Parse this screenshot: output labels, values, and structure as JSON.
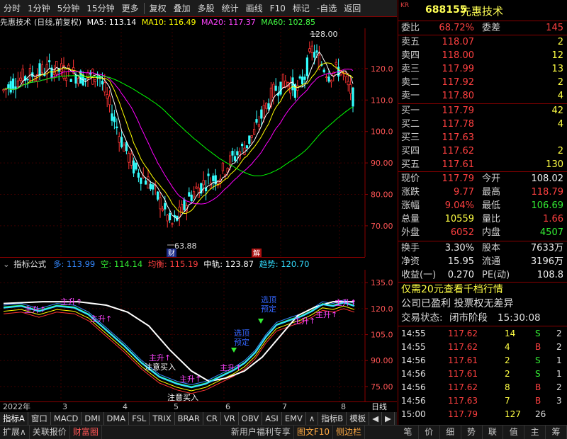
{
  "toolbar": {
    "items": [
      "分时",
      "1分钟",
      "5分钟",
      "15分钟",
      "更多",
      "复权",
      "叠加",
      "多股",
      "统计",
      "画线",
      "F10",
      "标记",
      "-自选",
      "返回"
    ]
  },
  "title_line": {
    "stock": "先惠技术",
    "period": "(日线,前复权)",
    "ma5": "MA5: 113.14",
    "ma10": "MA10: 116.49",
    "ma20": "MA20: 117.37",
    "ma60": "MA60: 102.85"
  },
  "price_chart": {
    "high_label": "128.00",
    "low_label": "63.88",
    "axis_ticks": [
      "120.0",
      "110.0",
      "100.0",
      "90.00",
      "80.00",
      "70.00"
    ],
    "tag_cai": "财",
    "tag_jie": "解",
    "colors": {
      "ma5": "#ffffff",
      "ma10": "#ffff00",
      "ma20": "#ff00ff",
      "ma60": "#00ff00",
      "up": "#ff3333",
      "down": "#33ffff"
    }
  },
  "indicator": {
    "label": "指标公式",
    "duo": "多: 113.99",
    "kong": "空: 114.14",
    "junheng": "均衡: 115.19",
    "zhonggui": "中轨: 123.87",
    "qushi": "趋势: 120.70",
    "axis_ticks": [
      "135.0",
      "120.0",
      "105.0",
      "90.00",
      "75.00"
    ],
    "annotations": {
      "rise": "主升↑",
      "note_buy": "注意买入",
      "select_a": "选顶",
      "select_b": "预定",
      "select_c": "选顶",
      "select_d": "预定"
    }
  },
  "date_axis": {
    "labels": [
      "2022年",
      "3",
      "4",
      "5",
      "6",
      "7",
      "8"
    ],
    "period_button": "日线"
  },
  "bottom_tabs": [
    "指标A",
    "窗口",
    "MACD",
    "DMI",
    "DMA",
    "FSL",
    "TRIX",
    "BRAR",
    "CR",
    "VR",
    "OBV",
    "ASI",
    "EMV",
    "∧",
    "指标B",
    "模板",
    "◀",
    "▶"
  ],
  "status_bar": [
    "扩展∧",
    "关联报价",
    "财富圈",
    "新用户福利专享",
    "图文F10",
    "侧边栏"
  ],
  "quote": {
    "kr": "KR",
    "code": "688155",
    "name": "先惠技术",
    "webi_label": "委比",
    "webi": "68.72%",
    "wecha_label": "委差",
    "wecha": "145",
    "sell": [
      {
        "label": "卖五",
        "price": "118.07",
        "vol": "2"
      },
      {
        "label": "卖四",
        "price": "118.00",
        "vol": "12"
      },
      {
        "label": "卖三",
        "price": "117.99",
        "vol": "13"
      },
      {
        "label": "卖二",
        "price": "117.92",
        "vol": "2"
      },
      {
        "label": "卖一",
        "price": "117.80",
        "vol": "4"
      }
    ],
    "buy": [
      {
        "label": "买一",
        "price": "117.79",
        "vol": "42"
      },
      {
        "label": "买二",
        "price": "117.78",
        "vol": "4"
      },
      {
        "label": "买三",
        "price": "117.63",
        "vol": ""
      },
      {
        "label": "买四",
        "price": "117.62",
        "vol": "2"
      },
      {
        "label": "买五",
        "price": "117.61",
        "vol": "130"
      }
    ],
    "stats": [
      {
        "l1": "现价",
        "v1": "117.79",
        "l2": "今开",
        "v2": "108.02"
      },
      {
        "l1": "涨跌",
        "v1": "9.77",
        "l2": "最高",
        "v2": "118.79"
      },
      {
        "l1": "涨幅",
        "v1": "9.04%",
        "l2": "最低",
        "v2": "106.69"
      },
      {
        "l1": "总量",
        "v1": "10559",
        "l2": "量比",
        "v2": "1.66"
      },
      {
        "l1": "外盘",
        "v1": "6052",
        "l2": "内盘",
        "v2": "4507"
      }
    ],
    "stats2": [
      {
        "l1": "换手",
        "v1": "3.30%",
        "l2": "股本",
        "v2": "7633万"
      },
      {
        "l1": "净资",
        "v1": "15.95",
        "l2": "流通",
        "v2": "3196万"
      },
      {
        "l1": "收益(一)",
        "v1": "0.270",
        "l2": "PE(动)",
        "v2": "108.8"
      }
    ],
    "promo": "仅需20元查看千档行情",
    "notice": "公司已盈利 投票权无差异",
    "trade_status_label": "交易状态:",
    "trade_status": "闭市阶段",
    "trade_time": "15:30:08",
    "ticks": [
      {
        "t": "14:55",
        "p": "117.62",
        "v": "14",
        "d": "S"
      },
      {
        "t": "14:55",
        "p": "117.62",
        "v": "4",
        "d": "B"
      },
      {
        "t": "14:56",
        "p": "117.61",
        "v": "2",
        "d": "S"
      },
      {
        "t": "14:56",
        "p": "117.61",
        "v": "2",
        "d": "S"
      },
      {
        "t": "14:56",
        "p": "117.62",
        "v": "8",
        "d": "B"
      },
      {
        "t": "14:56",
        "p": "117.63",
        "v": "7",
        "d": "B"
      },
      {
        "t": "15:00",
        "p": "117.79",
        "v": "127",
        "d": "26"
      }
    ],
    "tick_counts": [
      "2",
      "2",
      "1",
      "1",
      "2",
      "3"
    ],
    "tabs": [
      "笔",
      "价",
      "细",
      "势",
      "联",
      "值",
      "主",
      "筹"
    ]
  }
}
